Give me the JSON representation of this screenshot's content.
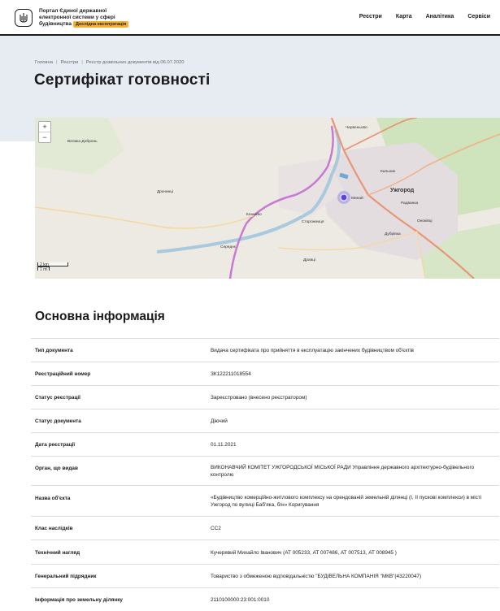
{
  "header": {
    "logo_line1": "Портал Єдиної державної",
    "logo_line2": "електронної системи у сфері",
    "logo_line3": "будівництва",
    "logo_badge": "Дослідна експлуатація",
    "nav": [
      "Реєстри",
      "Карта",
      "Аналітика",
      "Сервіси"
    ]
  },
  "breadcrumb": [
    "Головна",
    "Реєстри",
    "Реєстр дозвільних документів від 06.07.2020"
  ],
  "page_title": "Сертифікат готовності",
  "map": {
    "zoom_in": "+",
    "zoom_out": "−",
    "scale_km": "2 km",
    "scale_mi": "1 mi",
    "places": [
      "Червеньово",
      "Кальник",
      "Ужгород",
      "Радванка",
      "Оноківці",
      "Концово",
      "Минай",
      "Сторожниця",
      "Дравці",
      "Драчинці",
      "Велика Добронь",
      "Дубрівка",
      "Середнє"
    ]
  },
  "main": {
    "section_title": "Основна інформація",
    "rows": [
      {
        "label": "Тип документа",
        "value": "Видача сертифіката про прийняття в експлуатацію закінчених будівництвом об'єктів"
      },
      {
        "label": "Реєстраційний номер",
        "value": "ЗК122211018554"
      },
      {
        "label": "Статус реєстрації",
        "value": "Зареєстровано (внесено реєстратором)"
      },
      {
        "label": "Статус документа",
        "value": "Діючий"
      },
      {
        "label": "Дата реєстрації",
        "value": "01.11.2021"
      },
      {
        "label": "Орган, що видав",
        "value": "ВИКОНАВЧИЙ КОМІТЕТ УЖГОРОДСЬКОЇ МІСЬКОЇ РАДИ Управління державного архітектурно-будівельного контролю"
      },
      {
        "label": "Назва об'єкта",
        "value": "«Будівництво комерційно-житлового комплексу на орендованій земельній ділянці (І, ІІ пускові комплекси) в місті Ужгород по вулиці Баб'яка, б/н» Коригування"
      },
      {
        "label": "Клас наслідків",
        "value": "СС2"
      },
      {
        "label": "Технічний нагляд",
        "value": "Кучерявий Михайло Іванович (АТ 005233, АТ 007486, АТ 007513, АТ 008945 )"
      },
      {
        "label": "Генеральний підрядник",
        "value": "Товариство з обмеженою відповідальністю \"БУДІВЕЛЬНА КОМПАНІЯ \"МКВ\"(43220047)"
      },
      {
        "label": "Інформація про земельну ділянку",
        "value": "2110100000:23:001:0010"
      }
    ]
  }
}
